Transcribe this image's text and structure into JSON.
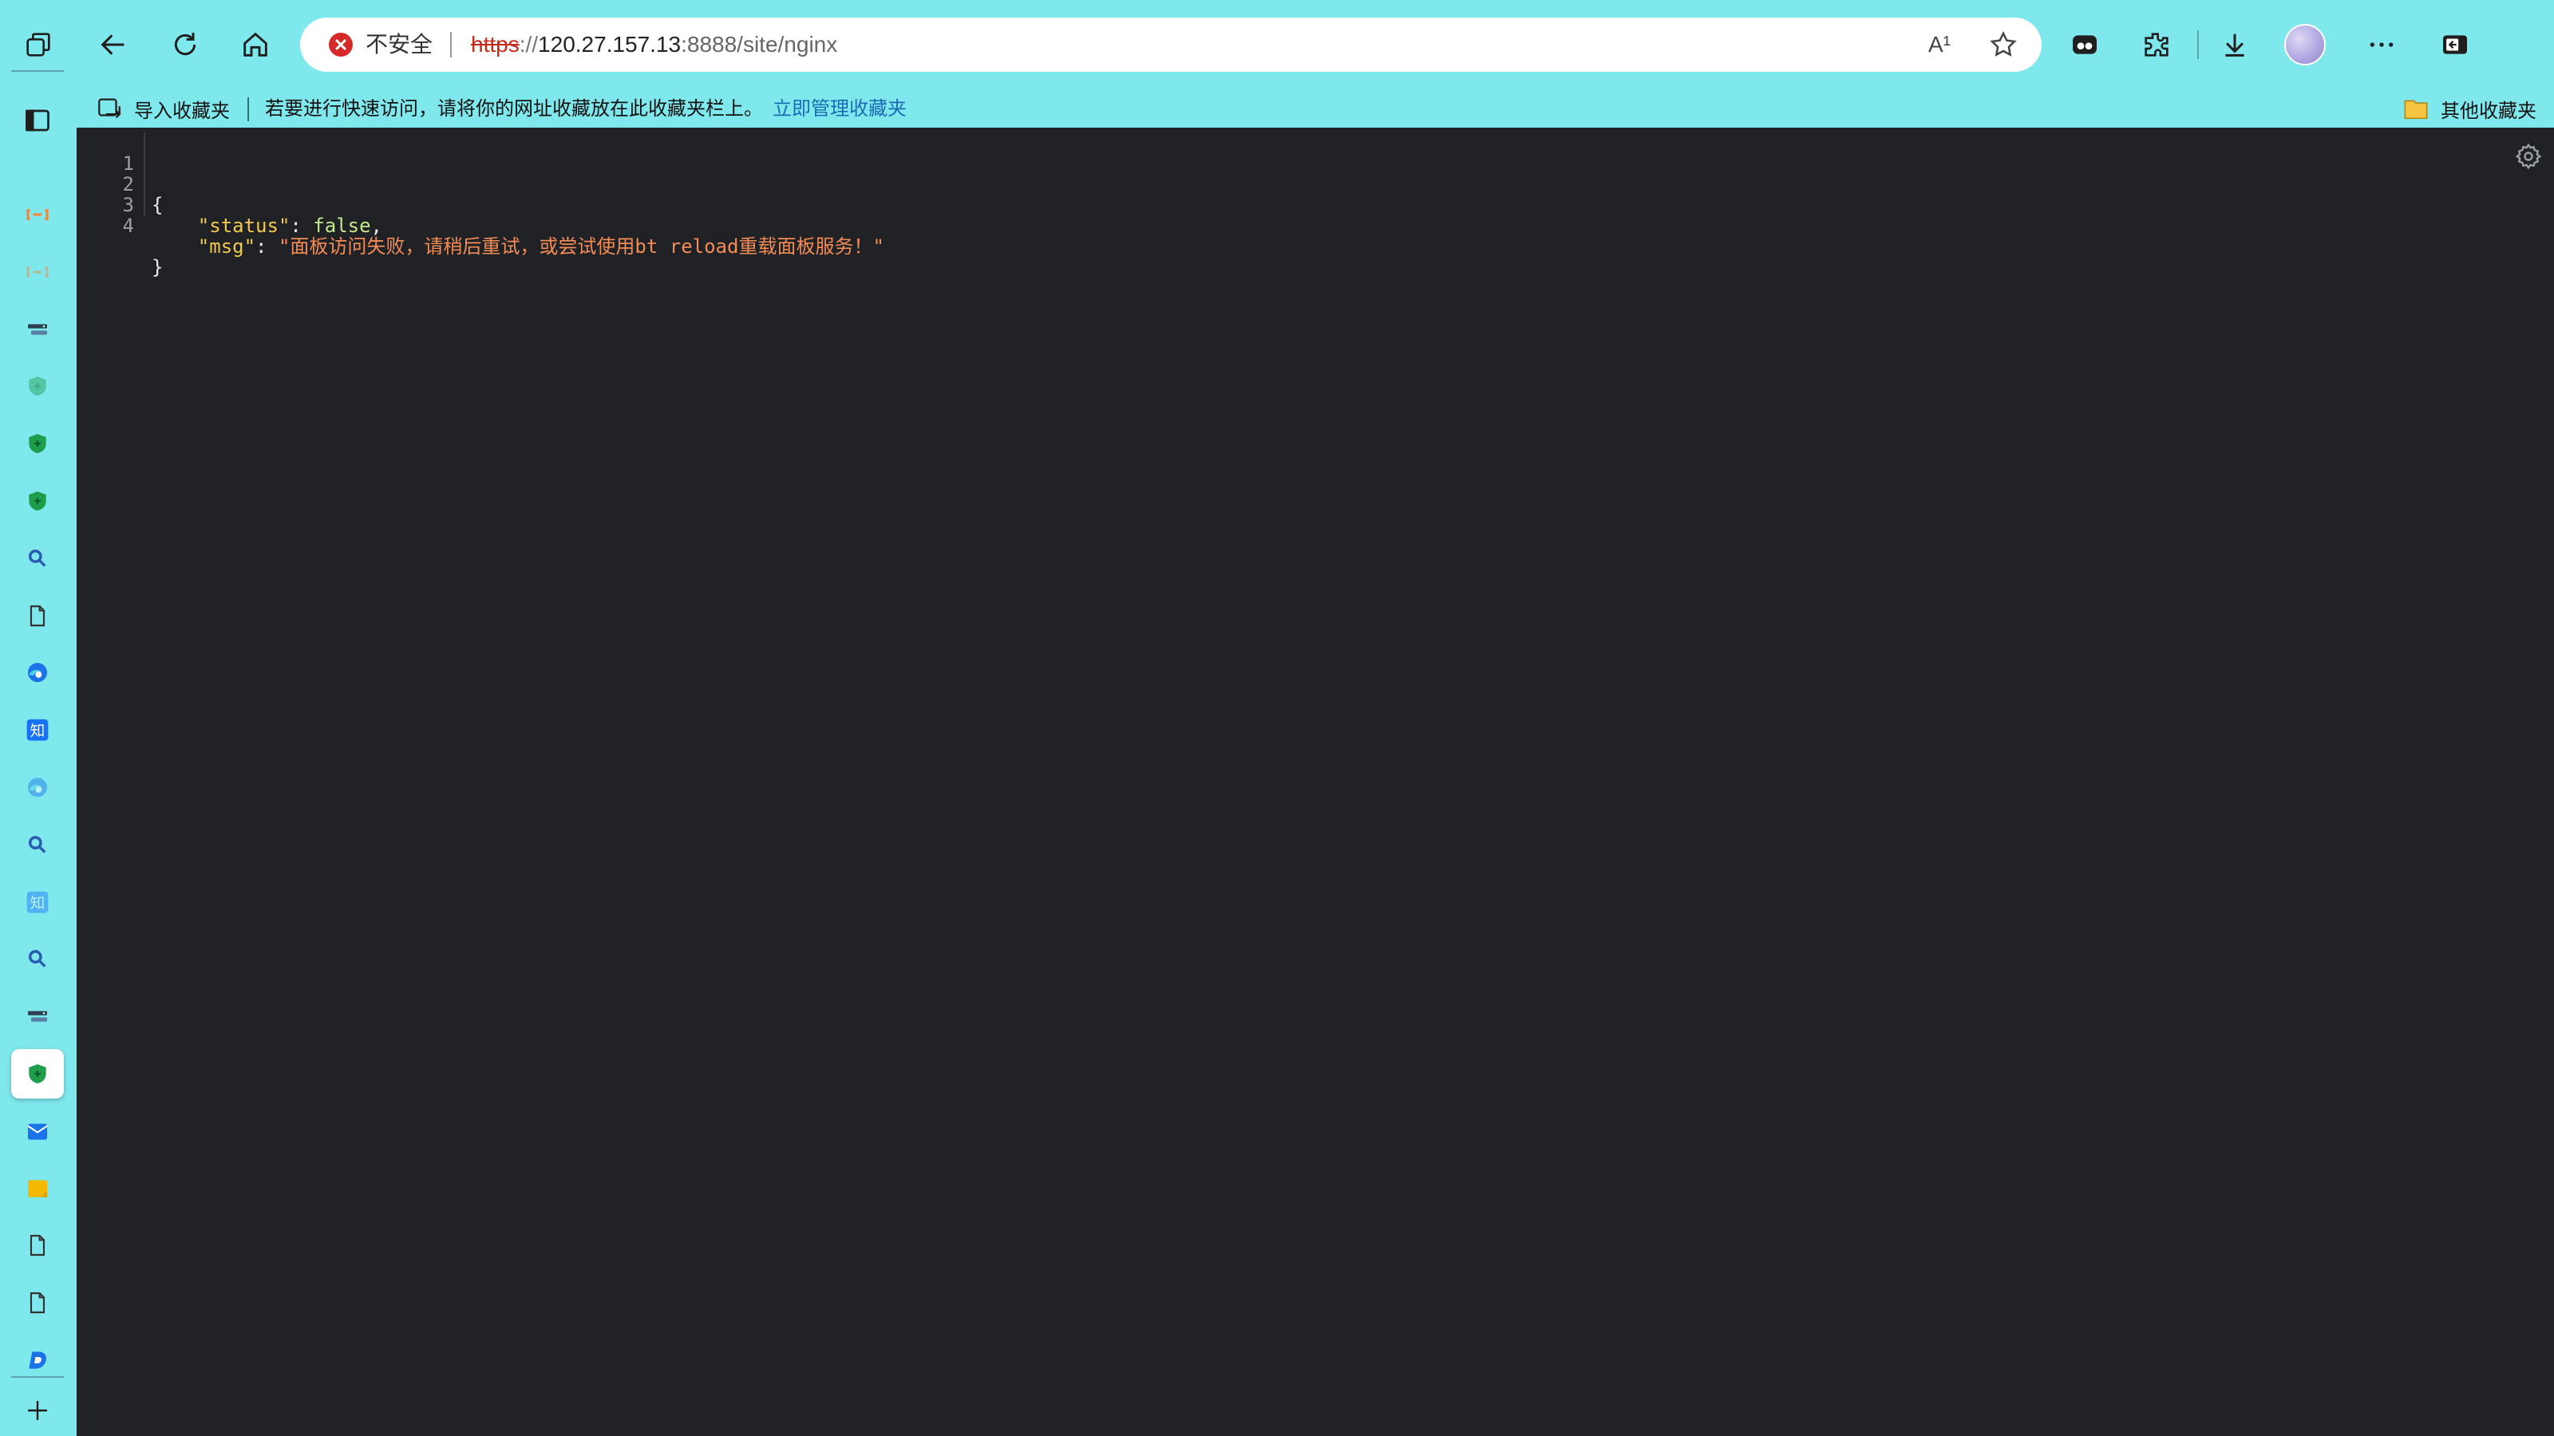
{
  "toolbar": {
    "security_label": "不安全",
    "url_scheme": "https",
    "url_sep": "://",
    "url_host": "120.27.157.13",
    "url_rest": ":8888/site/nginx",
    "read_aloud_text": "A¹",
    "more_icon": "..."
  },
  "favorites_bar": {
    "import_label": "导入收藏夹",
    "hint_text": "若要进行快速访问，请将你的网址收藏放在此收藏夹栏上。",
    "manage_link": "立即管理收藏夹",
    "other_label": "其他收藏夹"
  },
  "sidebar": {
    "tabs": [
      {
        "icon": "baota-link-icon",
        "color": "#f0883e"
      },
      {
        "icon": "baota-link-icon",
        "color": "#f0883e"
      },
      {
        "icon": "server-icon",
        "color": "#2c3e50"
      },
      {
        "icon": "shield-icon",
        "color": "#1e9e4a"
      },
      {
        "icon": "shield-icon",
        "color": "#1e9e4a"
      },
      {
        "icon": "shield-icon",
        "color": "#1e9e4a"
      },
      {
        "icon": "search-icon",
        "color": "#2a5db0"
      },
      {
        "icon": "document-icon",
        "color": "#333333"
      },
      {
        "icon": "edge-icon",
        "color": "#1a73e8"
      },
      {
        "icon": "zhihu-icon",
        "color": "#1772f6",
        "text": "知"
      },
      {
        "icon": "edge-icon",
        "color": "#1a73e8"
      },
      {
        "icon": "search-icon",
        "color": "#2a5db0"
      },
      {
        "icon": "zhihu-icon",
        "color": "#1772f6",
        "text": "知"
      },
      {
        "icon": "search-icon",
        "color": "#2a5db0"
      },
      {
        "icon": "server-icon",
        "color": "#2c3e50"
      },
      {
        "icon": "shield-icon",
        "color": "#1e9e4a",
        "active": true
      },
      {
        "icon": "outlook-icon",
        "color": "#1a73e8"
      },
      {
        "icon": "notes-icon",
        "color": "#f5b800"
      },
      {
        "icon": "document-icon",
        "color": "#333333"
      },
      {
        "icon": "document-icon",
        "color": "#333333"
      },
      {
        "icon": "d-logo-icon",
        "color": "#1a73e8"
      }
    ]
  },
  "json_viewer": {
    "line_numbers": [
      "1",
      "2",
      "3",
      "4"
    ],
    "open_brace": "{",
    "close_brace": "}",
    "status_key": "\"status\"",
    "status_value": "false",
    "msg_key": "\"msg\"",
    "msg_value": "\"面板访问失败，请稍后重试，或尝试使用bt reload重载面板服务！\"",
    "colon": ": ",
    "comma": ","
  },
  "colors": {
    "browser_chrome": "#7fe8ed",
    "viewer_background": "#202124",
    "json_key": "#f2c94c",
    "json_bool": "#c3e88d",
    "json_string": "#f28b54",
    "insecure_red": "#c42b1c"
  }
}
